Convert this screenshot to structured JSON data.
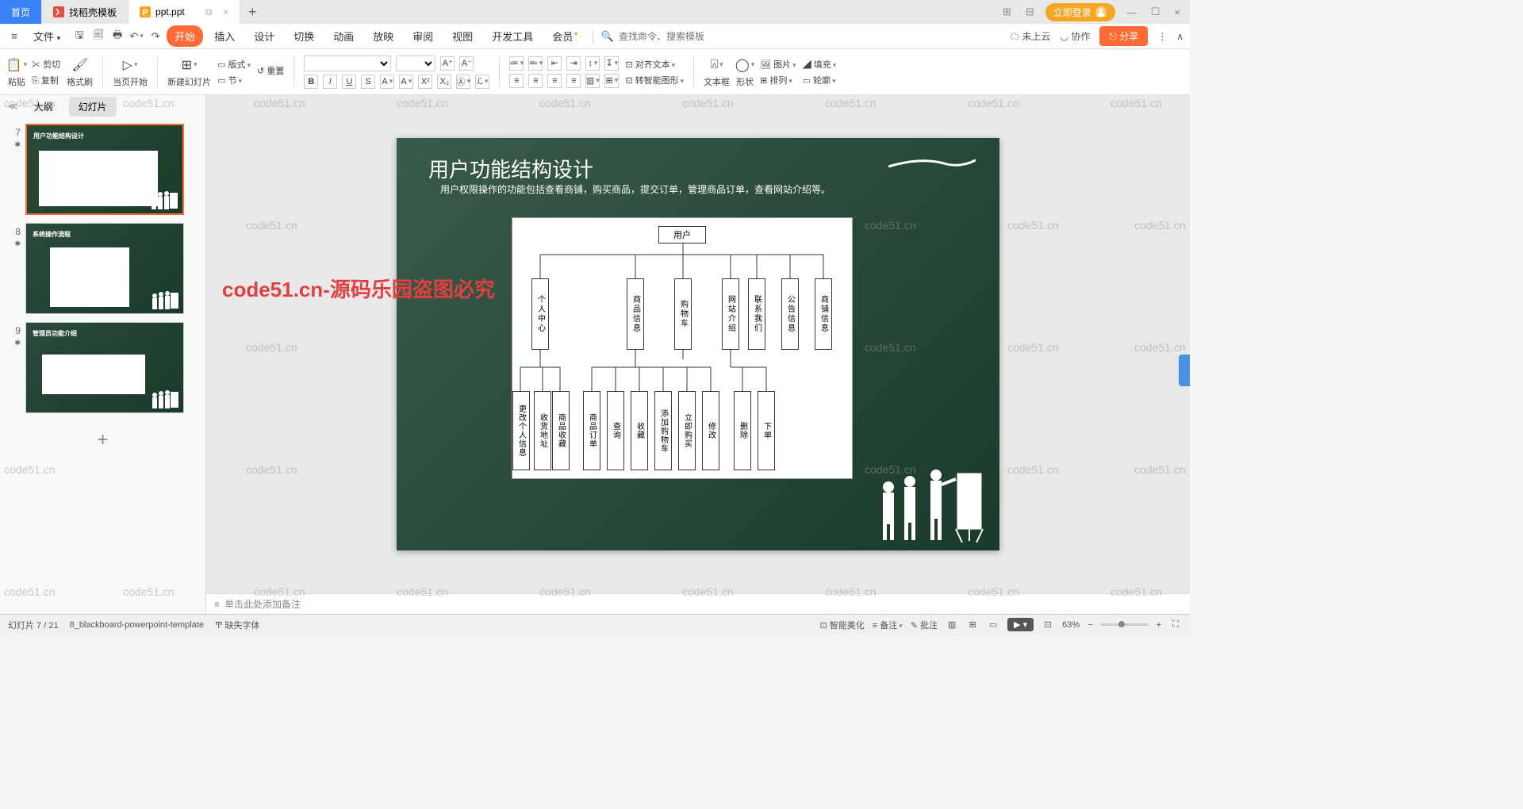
{
  "tabs": {
    "home": "首页",
    "t1": "找稻壳模板",
    "t2": "ppt.ppt"
  },
  "tabbar": {
    "login": "立即登录"
  },
  "menu": {
    "file": "文件",
    "start": "开始",
    "insert": "插入",
    "design": "设计",
    "transition": "切换",
    "animation": "动画",
    "slideshow": "放映",
    "review": "审阅",
    "view": "视图",
    "devtools": "开发工具",
    "member": "会员",
    "search_ph": "查找命令、搜索模板",
    "cloud": "未上云",
    "collab": "协作",
    "share": "分享"
  },
  "ribbon": {
    "paste": "粘贴",
    "cut": "剪切",
    "copy": "复制",
    "format": "格式刷",
    "fromhere": "当页开始",
    "newslide": "新建幻灯片",
    "layout": "版式",
    "reset": "重置",
    "section": "节",
    "align": "对齐文本",
    "smartart": "转智能图形",
    "textbox": "文本框",
    "shape": "形状",
    "image": "图片",
    "arrange": "排列",
    "fill": "填充",
    "outline": "轮廓"
  },
  "side": {
    "outline": "大纲",
    "slides": "幻灯片"
  },
  "thumbs": [
    {
      "n": "7",
      "title": "用户功能结构设计"
    },
    {
      "n": "8",
      "title": "系统操作流程"
    },
    {
      "n": "9",
      "title": "管理员功能介绍"
    }
  ],
  "slide": {
    "title": "用户功能结构设计",
    "sub": "用户权限操作的功能包括查看商铺，购买商品，提交订单，管理商品订单，查看网站介绍等。",
    "root": "用户",
    "mid": [
      "个人中心",
      "商品信息",
      "购物车",
      "网站介绍",
      "联系我们",
      "公告信息",
      "商铺信息"
    ],
    "leaf": [
      "更改个人信息",
      "收货地址",
      "商品收藏",
      "商品订单",
      "查询",
      "收藏",
      "添加购物车",
      "立即购买",
      "修改",
      "删除",
      "下单"
    ]
  },
  "wm": {
    "big": "code51.cn-源码乐园盗图必究",
    "small": "code51.cn"
  },
  "notes": "单击此处添加备注",
  "status": {
    "pos": "幻灯片 7 / 21",
    "tpl": "8_blackboard-powerpoint-template",
    "font": "缺失字体",
    "smart": "智能美化",
    "notes": "备注",
    "comment": "批注",
    "zoom": "63%"
  }
}
